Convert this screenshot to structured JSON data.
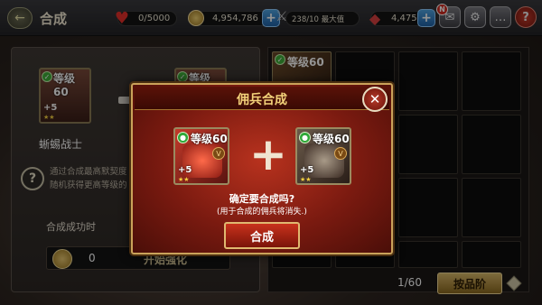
{
  "header": {
    "back_icon": "back-arrow-icon",
    "title": "合成",
    "hearts": "0/5000",
    "gold": "4,954,786",
    "units": "238/10 最大值",
    "gems": "4,475",
    "notification_badge": "N"
  },
  "left_panel": {
    "card_level": "等级60",
    "card_plus": "+5",
    "card_stars": "★★",
    "merc_name": "蜥蜴战士",
    "info_line1": "通过合成最高默契度",
    "info_line2": "随机获得更高等级的",
    "success_label": "合成成功时",
    "cost": "0",
    "start_button_label": "开始强化"
  },
  "inventory": {
    "first_cell_level": "等级60",
    "page_indicator": "1/60",
    "sort_button_label": "按品阶"
  },
  "dialog": {
    "title": "佣兵合成",
    "card_level": "等级60",
    "card_plus": "+5",
    "card_stars": "★★",
    "plus_symbol": "+",
    "confirm_question": "确定要合成吗?",
    "confirm_note": "(用于合成的佣兵将消失.)",
    "merge_button_label": "合成"
  },
  "colors": {
    "dialog_red": "#b8321e",
    "gold_border": "#caa25a",
    "sort_button": "#d8b868"
  }
}
